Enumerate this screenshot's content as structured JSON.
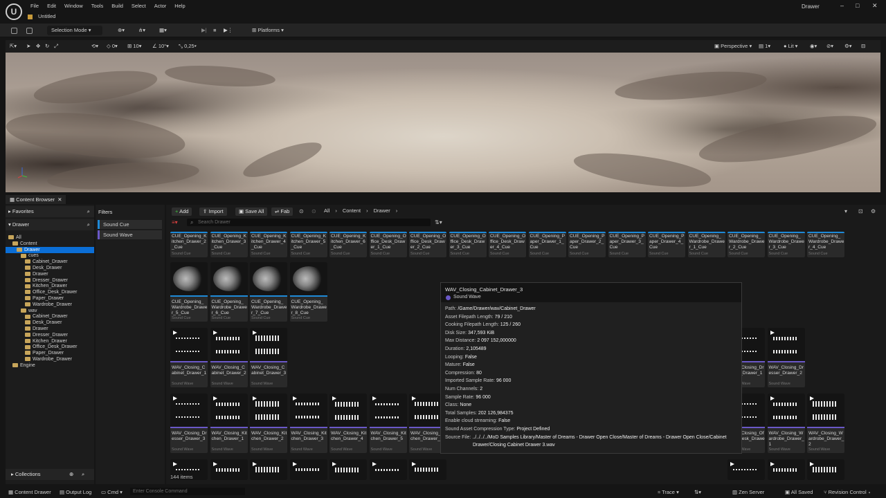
{
  "app": {
    "window_title": "Drawer",
    "document_tab": "Untitled",
    "menu": [
      "File",
      "Edit",
      "Window",
      "Tools",
      "Build",
      "Select",
      "Actor",
      "Help"
    ]
  },
  "toolbar": {
    "selection_mode": "Selection Mode",
    "platforms": "Platforms"
  },
  "viewport_toolbar": {
    "grid_angle": "0",
    "grid_snap": "10",
    "rotate_snap": "10°",
    "scale_snap": "0,25",
    "view_mode": "Perspective",
    "lit": "Lit",
    "layout": "1"
  },
  "content_browser": {
    "tab": "Content Browser",
    "favorites": "Favorites",
    "root": "Drawer",
    "tree": [
      {
        "label": "All",
        "indent": 0
      },
      {
        "label": "Content",
        "indent": 1
      },
      {
        "label": "Drawer",
        "indent": 2,
        "selected": true
      },
      {
        "label": "cues",
        "indent": 3
      },
      {
        "label": "Cabinet_Drawer",
        "indent": 4
      },
      {
        "label": "Desk_Drawer",
        "indent": 4
      },
      {
        "label": "Drawer",
        "indent": 4
      },
      {
        "label": "Dresser_Drawer",
        "indent": 4
      },
      {
        "label": "Kitchen_Drawer",
        "indent": 4
      },
      {
        "label": "Office_Desk_Drawer",
        "indent": 4
      },
      {
        "label": "Paper_Drawer",
        "indent": 4
      },
      {
        "label": "Wardrobe_Drawer",
        "indent": 4
      },
      {
        "label": "wav",
        "indent": 3
      },
      {
        "label": "Cabinet_Drawer",
        "indent": 4
      },
      {
        "label": "Desk_Drawer",
        "indent": 4
      },
      {
        "label": "Drawer",
        "indent": 4
      },
      {
        "label": "Dresser_Drawer",
        "indent": 4
      },
      {
        "label": "Kitchen_Drawer",
        "indent": 4
      },
      {
        "label": "Office_Desk_Drawer",
        "indent": 4
      },
      {
        "label": "Paper_Drawer",
        "indent": 4
      },
      {
        "label": "Wardrobe_Drawer",
        "indent": 4
      },
      {
        "label": "Engine",
        "indent": 1
      }
    ],
    "collections": "Collections",
    "filters_title": "Filters",
    "filters": [
      {
        "label": "Sound Cue",
        "color": "#1e8ad8"
      },
      {
        "label": "Sound Wave",
        "color": "#6a58c8"
      }
    ],
    "buttons": {
      "add": "Add",
      "import": "Import",
      "save_all": "Save All",
      "fab": "Fab"
    },
    "breadcrumb": [
      "All",
      "Content",
      "Drawer"
    ],
    "search_placeholder": "Search Drawer",
    "item_count": "144 items",
    "rows": [
      {
        "type": "Sound Cue",
        "color": "#1e8ad8",
        "thumb": "none",
        "items": [
          "CUE_Opening_Kitchen_Drawer_2_Cue",
          "CUE_Opening_Kitchen_Drawer_3_Cue",
          "CUE_Opening_Kitchen_Drawer_4_Cue",
          "CUE_Opening_Kitchen_Drawer_5_Cue",
          "CUE_Opening_Kitchen_Drawer_6_Cue",
          "CUE_Opening_Office_Desk_Drawer_1_Cue",
          "CUE_Opening_Office_Desk_Drawer_2_Cue",
          "CUE_Opening_Office_Desk_Drawer_3_Cue",
          "CUE_Opening_Office_Desk_Drawer_4_Cue",
          "CUE_Opening_Paper_Drawer_1_Cue",
          "CUE_Opening_Paper_Drawer_2_Cue",
          "CUE_Opening_Paper_Drawer_3_Cue",
          "CUE_Opening_Paper_Drawer_4_Cue",
          "CUE_Opening_Wardrobe_Drawer_1_Cue",
          "CUE_Opening_Wardrobe_Drawer_2_Cue",
          "CUE_Opening_Wardrobe_Drawer_3_Cue",
          "CUE_Opening_Wardrobe_Drawer_4_Cue"
        ]
      },
      {
        "type": "Sound Cue",
        "color": "#1e8ad8",
        "thumb": "speaker",
        "items": [
          "CUE_Opening_Wardrobe_Drawer_5_Cue",
          "CUE_Opening_Wardrobe_Drawer_6_Cue",
          "CUE_Opening_Wardrobe_Drawer_7_Cue",
          "CUE_Opening_Wardrobe_Drawer_8_Cue"
        ]
      },
      {
        "type": "Sound Wave",
        "color": "#6a58c8",
        "thumb": "wave",
        "items": [
          "WAV_Closing_Cabinet_Drawer_1",
          "WAV_Closing_Cabinet_Drawer_2",
          "WAV_Closing_Cabinet_Drawer_3",
          "",
          "",
          "",
          "",
          "",
          "",
          "",
          "",
          "",
          "",
          "WAV_Closing_Dresser_Drawer_4",
          "WAV_Closing_Dresser_Drawer_1",
          "WAV_Closing_Dresser_Drawer_2"
        ]
      },
      {
        "type": "Sound Wave",
        "color": "#6a58c8",
        "thumb": "wave",
        "items": [
          "WAV_Closing_Dresser_Drawer_3",
          "WAV_Closing_Kitchen_Drawer_1",
          "WAV_Closing_Kitchen_Drawer_2",
          "WAV_Closing_Kitchen_Drawer_3",
          "WAV_Closing_Kitchen_Drawer_4",
          "WAV_Closing_Kitchen_Drawer_5",
          "WAV_Closing_Kitchen_Drawer_6",
          "",
          "",
          "",
          "",
          "",
          "",
          "",
          "WAV_Closing_Office_Desk_Drawer_4",
          "WAV_Closing_Wardrobe_Drawer_1",
          "WAV_Closing_Wardrobe_Drawer_2"
        ]
      },
      {
        "type": "Sound Wave",
        "color": "#6a58c8",
        "thumb": "wave",
        "items": [
          "WAV_Closing_Wardrobe_Drawer_3",
          "WAV_Closing_Wardrobe_Drawer_4",
          "WAV_Closing_Wardrobe_Drawer_5",
          "WAV_Closing_Wardrobe_Drawer_6",
          "WAV_Closing_Wardrobe_Drawer_7",
          "WAV_Closing_Wardrobe_Drawer_8",
          "WAV_Opening_Cabinet_Drawer_1",
          "",
          "",
          "",
          "",
          "",
          "",
          "",
          "WAV_Opening_Paper_Drawer_2",
          "WAV_Opening_Wardrobe_Drawer_3",
          "WAV_Opening_Wardrobe_Drawer_4"
        ]
      }
    ]
  },
  "tooltip": {
    "title": "WAV_Closing_Cabinet_Drawer_3",
    "subtitle": "Sound Wave",
    "props": [
      {
        "k": "Path:",
        "v": "/Game/Drawer/wav/Cabinet_Drawer"
      },
      {
        "k": "Asset Filepath Length:",
        "v": "79 / 210"
      },
      {
        "k": "Cooking Filepath Length:",
        "v": "125 / 260"
      },
      {
        "k": "Disk Size:",
        "v": "347,593 KiB"
      },
      {
        "k": "Max Distance:",
        "v": "2 097 152,000000"
      },
      {
        "k": "Duration:",
        "v": "2,105489"
      },
      {
        "k": "Looping:",
        "v": "False"
      },
      {
        "k": "Mature:",
        "v": "False"
      },
      {
        "k": "Compression:",
        "v": "80"
      },
      {
        "k": "Imported Sample Rate:",
        "v": "96 000"
      },
      {
        "k": "Num Channels:",
        "v": "2"
      },
      {
        "k": "Sample Rate:",
        "v": "96 000"
      },
      {
        "k": "Class:",
        "v": "None"
      },
      {
        "k": "Total Samples:",
        "v": "202 126,984375"
      },
      {
        "k": "Enable cloud streaming:",
        "v": "False"
      },
      {
        "k": "Sound Asset Compression Type:",
        "v": "Project Defined"
      },
      {
        "k": "Source File:",
        "v": "../../../../MoD Samples Library/Master of Dreams - Drawer Open Close/Master of Dreams - Drawer Open Close/Cabinet"
      },
      {
        "k": "",
        "v": "Drawer/Closing Cabinet Drawer 3.wav"
      }
    ]
  },
  "statusbar": {
    "content_drawer": "Content Drawer",
    "output_log": "Output Log",
    "cmd": "Cmd",
    "console_placeholder": "Enter Console Command",
    "trace": "Trace",
    "zen_server": "Zen Server",
    "all_saved": "All Saved",
    "revision_control": "Revision Control"
  }
}
